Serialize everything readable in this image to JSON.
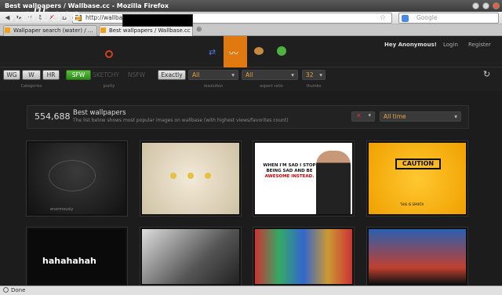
{
  "window": {
    "title": "Best wallpapers / Wallbase.cc - Mozilla Firefox"
  },
  "browser": {
    "url": "http://wallbase.cc/toplist",
    "search_placeholder": "Google",
    "tabs": [
      {
        "label": "Wallpaper search (water) / ...",
        "active": false
      },
      {
        "label": "Best wallpapers / Wallbase.cc",
        "active": true
      }
    ],
    "status": "Done"
  },
  "site": {
    "logo": "wallbase",
    "greeting": "Hey Anonymous!",
    "login": "Login",
    "register": "Register",
    "accent": "#e07a10"
  },
  "filters": {
    "categories": [
      "WG",
      "W",
      "HR"
    ],
    "categories_label": "Categories",
    "purity": [
      "SFW",
      "SKETCHY",
      "NSFW"
    ],
    "purity_label": "purity",
    "exactly": "Exactly",
    "resolution": "All",
    "resolution_label": "resolution",
    "aspect": "All",
    "aspect_label": "aspect ratio",
    "thumbs": "32",
    "thumbs_label": "thumbs"
  },
  "toplist": {
    "count": "554,688",
    "title": "Best wallpapers",
    "subtitle": "The list below shows most popular images on wallbase (with highest views/favorites count)",
    "timeframe": "All time"
  },
  "thumbnails": {
    "caution": "CAUTION",
    "sparta": "THIS IS SPARTA",
    "haha": "hahahahah",
    "meme_line1": "WHEN I'M SAD I STOP",
    "meme_line2": "BEING SAD AND BE",
    "meme_line3": "AWESOME INSTEAD.",
    "enormously": "enormously"
  }
}
